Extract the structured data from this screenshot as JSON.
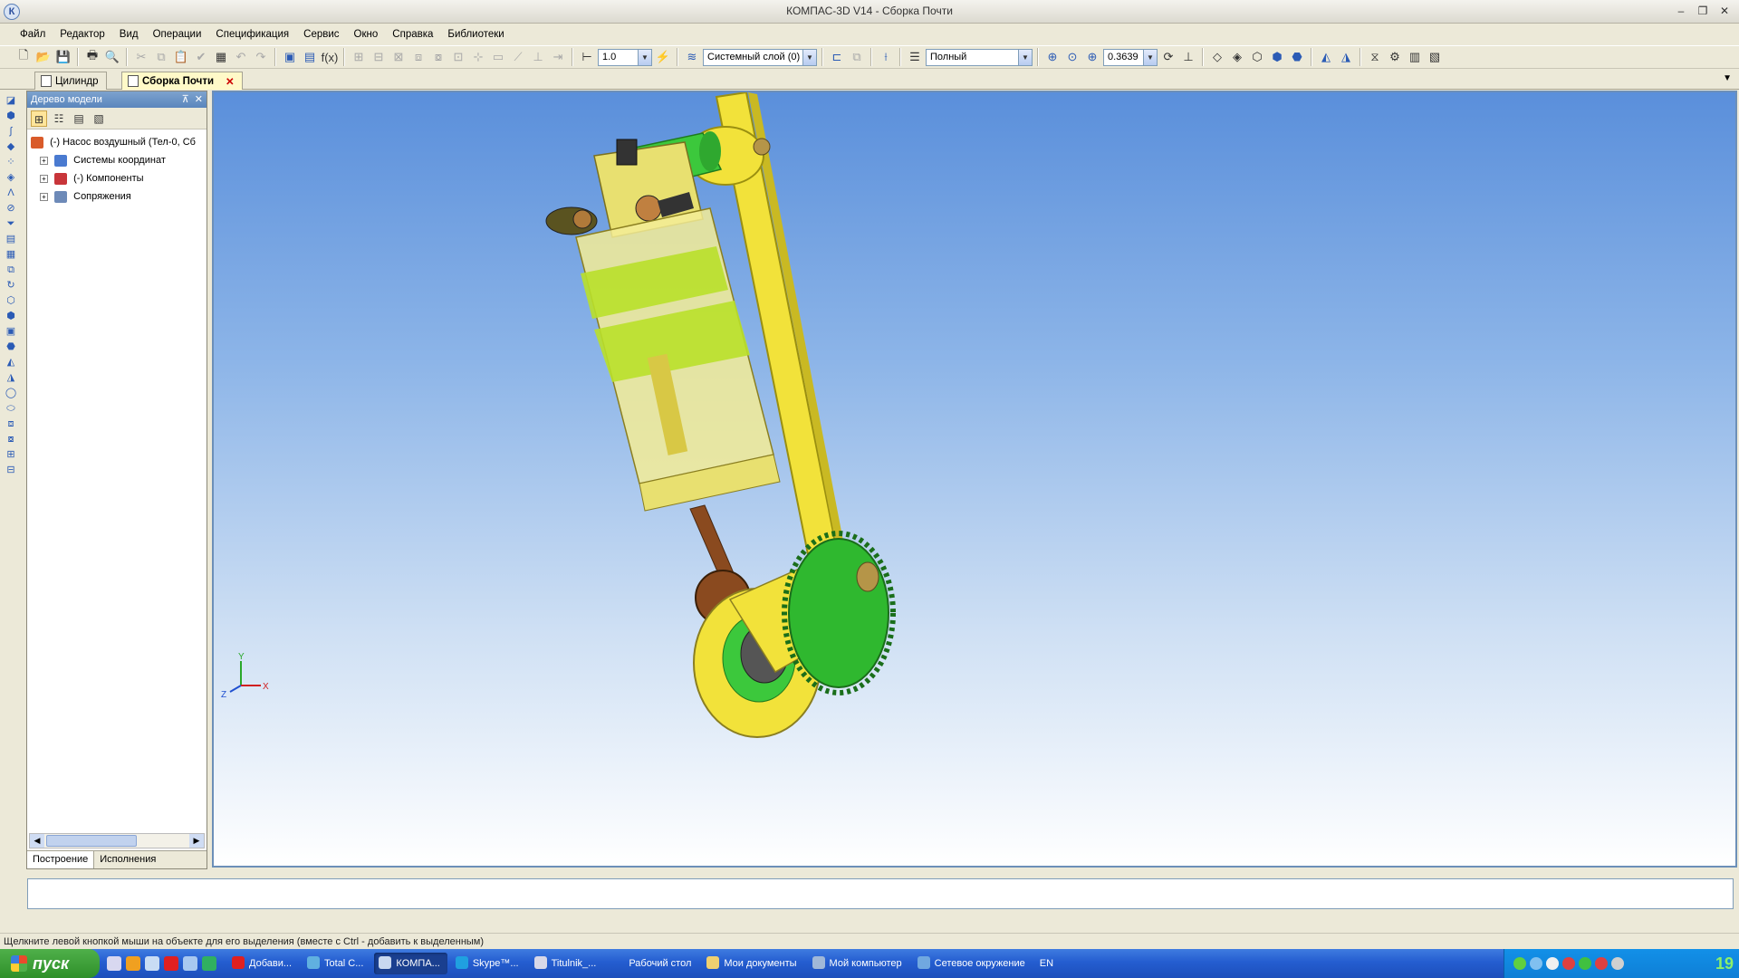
{
  "window": {
    "title": "КОМПАС-3D V14 - Сборка Почти"
  },
  "menu": [
    "Файл",
    "Редактор",
    "Вид",
    "Операции",
    "Спецификация",
    "Сервис",
    "Окно",
    "Справка",
    "Библиотеки"
  ],
  "toolbar": {
    "step_value": "1.0",
    "layer_value": "Системный слой (0)",
    "view_mode_value": "Полный",
    "zoom_value": "0.3639"
  },
  "doc_tabs": [
    {
      "label": "Цилиндр",
      "active": false
    },
    {
      "label": "Сборка Почти",
      "active": true
    }
  ],
  "tree_panel": {
    "title": "Дерево модели",
    "nodes": [
      {
        "label": "(-) Насос воздушный (Тел-0, Сб"
      },
      {
        "label": "Системы координат"
      },
      {
        "label": "(-) Компоненты"
      },
      {
        "label": "Сопряжения"
      }
    ],
    "tabs": [
      "Построение",
      "Исполнения"
    ]
  },
  "axes": {
    "y": "Y",
    "z": "Z",
    "x": "X"
  },
  "status": {
    "hint": "Щелкните левой кнопкой мыши на объекте для его выделения (вместе с Ctrl - добавить к выделенным)"
  },
  "taskbar": {
    "start_label": "пуск",
    "tasks": [
      "Добави...",
      "Total C...",
      "КОМПА...",
      "Skype™...",
      "Titulnik_...",
      "Рабочий стол",
      "Мои документы",
      "Мой компьютер",
      "Сетевое окружение"
    ],
    "active_task": "КОМПА...",
    "lang": "EN",
    "clock": "19"
  },
  "colors": {
    "viewport_top": "#5a8fdb",
    "yellow_part": "#f2e23a",
    "green_part": "#3cc83c",
    "rod": "#8a4a1f"
  }
}
